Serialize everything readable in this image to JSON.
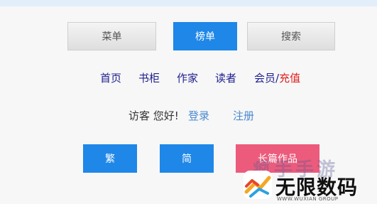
{
  "top_buttons": {
    "menu": "菜单",
    "rank": "榜单",
    "search": "搜索"
  },
  "nav": {
    "home": "首页",
    "bookshelf": "书柜",
    "author": "作家",
    "reader": "读者",
    "member": "会员",
    "separator": "/",
    "recharge": "充值"
  },
  "greeting": {
    "text": "访客 您好!",
    "login": "登录",
    "register": "注册"
  },
  "bottom_buttons": {
    "traditional": "繁",
    "simplified": "简",
    "works": "长篇作品"
  },
  "watermark": {
    "faded_text": "疯手手游",
    "main": "无限数码",
    "sub": "WWW.WUXIAN GROUP"
  },
  "colors": {
    "primary_blue": "#1e87e8",
    "pink": "#ec5b7c",
    "nav_link": "#1f1f8f",
    "recharge_red": "#e01e1e"
  }
}
